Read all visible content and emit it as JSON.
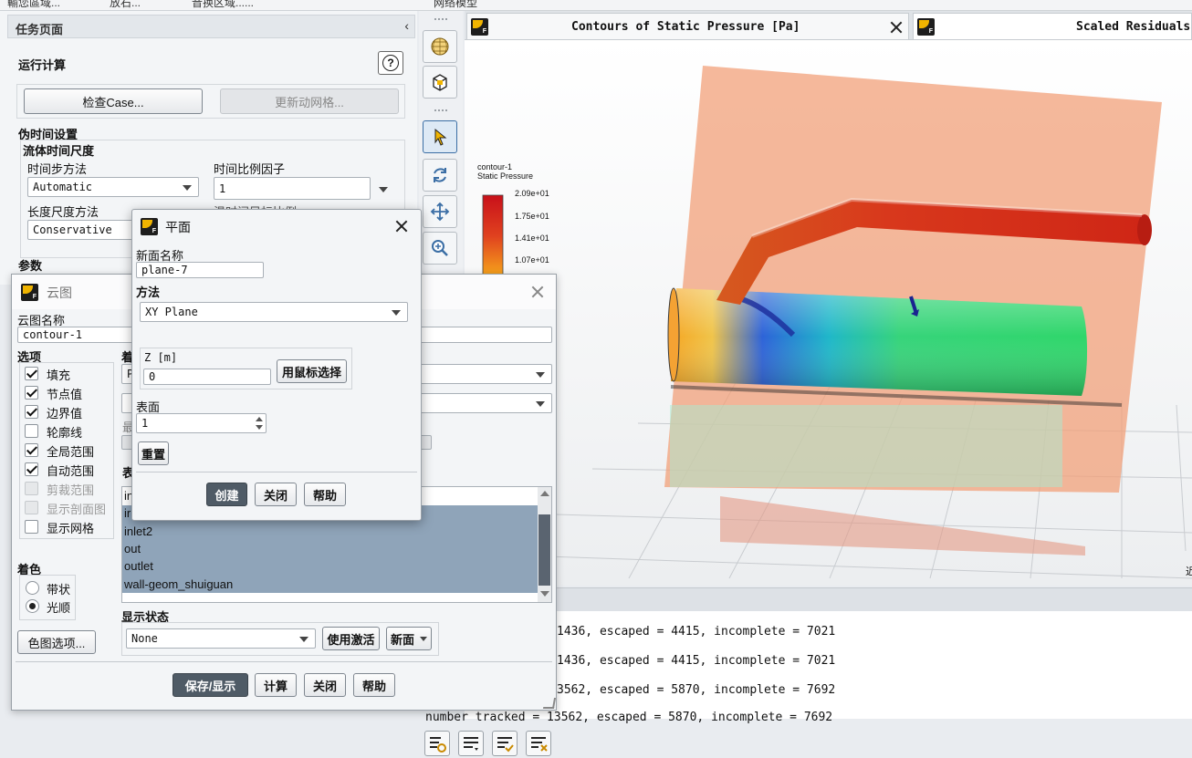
{
  "top_tabs": [
    "輸您區域...",
    "放石...",
    "音换区域......",
    "",
    "网络模型",
    ""
  ],
  "task_panel": {
    "title": "任务页面",
    "section": "运行计算",
    "check_case": "检查Case...",
    "update_mesh": "更新动网格...",
    "pseudo_time": "伪时间设置",
    "fluid_time_scale": "流体时间尺度",
    "time_step_method_label": "时间步方法",
    "time_step_method": "Automatic",
    "time_scale_factor_label": "时间比例因子",
    "time_scale_factor": "1",
    "length_scale_label": "长度尺度方法",
    "length_scale": "Conservative",
    "params": "参数",
    "hidden_text": "温时间目标比例"
  },
  "viewer": {
    "tab1": "Contours of Static Pressure [Pa]",
    "tab2": "Scaled Residuals",
    "legend_name": "contour-1",
    "legend_var": "Static Pressure",
    "legend_ticks": [
      "2.09e+01",
      "1.75e+01",
      "1.41e+01",
      "1.07e+01"
    ],
    "right_edge_text": "近"
  },
  "console": {
    "lines": [
      "1436, escaped = 4415, incomplete = 7021",
      "1436, escaped = 4415, incomplete = 7021",
      "3562, escaped = 5870, incomplete = 7692",
      "number tracked = 13562, escaped = 5870, incomplete = 7692"
    ]
  },
  "contour_dialog": {
    "title": "云图",
    "name_label": "云图名称",
    "name_value": "contour-1",
    "options_label": "选项",
    "options": [
      {
        "label": "填充",
        "checked": true,
        "enabled": true
      },
      {
        "label": "节点值",
        "checked": true,
        "enabled": true
      },
      {
        "label": "边界值",
        "checked": true,
        "enabled": true
      },
      {
        "label": "轮廓线",
        "checked": false,
        "enabled": true
      },
      {
        "label": "全局范围",
        "checked": true,
        "enabled": true
      },
      {
        "label": "自动范围",
        "checked": true,
        "enabled": true
      },
      {
        "label": "剪裁范围",
        "checked": false,
        "enabled": false
      },
      {
        "label": "显示剖面图",
        "checked": false,
        "enabled": false
      },
      {
        "label": "显示网格",
        "checked": false,
        "enabled": true
      }
    ],
    "partial_labels": [
      "着",
      "P",
      "最",
      "表"
    ],
    "coloring_label": "着色",
    "coloring": [
      {
        "label": "带状",
        "selected": false
      },
      {
        "label": "光顺",
        "selected": true
      }
    ],
    "colormap_options": "色图选项...",
    "surfaces": [
      "in",
      "ir",
      "inlet2",
      "out",
      "outlet",
      "wall-geom_shuiguan"
    ],
    "display_state_label": "显示状态",
    "display_state": "None",
    "use_active": "使用激活",
    "new_btn": "新面",
    "save_display": "保存/显示",
    "compute": "计算",
    "close": "关闭",
    "help": "帮助"
  },
  "plane_dialog": {
    "title": "平面",
    "new_name_label": "新面名称",
    "new_name": "plane-7",
    "method_label": "方法",
    "method": "XY Plane",
    "z_label": "Z [m]",
    "z_value": "0",
    "select_by_mouse": "用鼠标选择",
    "surface_label": "表面",
    "surface_value": "1",
    "reset": "重置",
    "create": "创建",
    "close": "关闭",
    "help": "帮助"
  },
  "colors": {
    "accent_dark": "#4f5b66",
    "selection": "#8fa4b9",
    "legend_top": "#c8101a",
    "legend_bottom": "#f7a81b"
  }
}
